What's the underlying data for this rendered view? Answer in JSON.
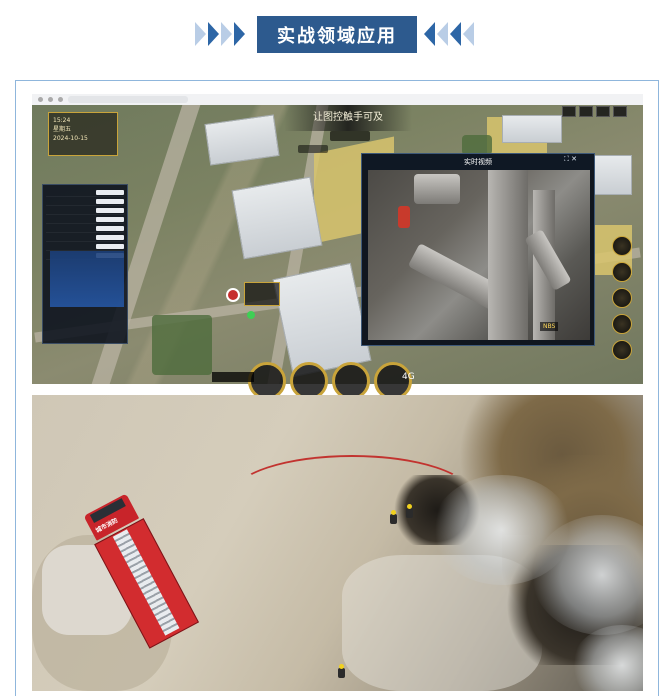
{
  "header": {
    "title": "实战领域应用"
  },
  "screenshot1": {
    "banner_title": "让图控触手可及",
    "video_panel_title": "实时视频",
    "video_tag": "NBS",
    "info_card": {
      "line1": "15:24",
      "line2": "星期五",
      "line3": "2024-10-15"
    },
    "signal_label": "4G"
  },
  "screenshot2": {
    "truck_label": "城市消防"
  },
  "colors": {
    "title_bg": "#2d5a8e",
    "chevron": "#2d66a6",
    "frame_border": "#8fb6dc"
  }
}
